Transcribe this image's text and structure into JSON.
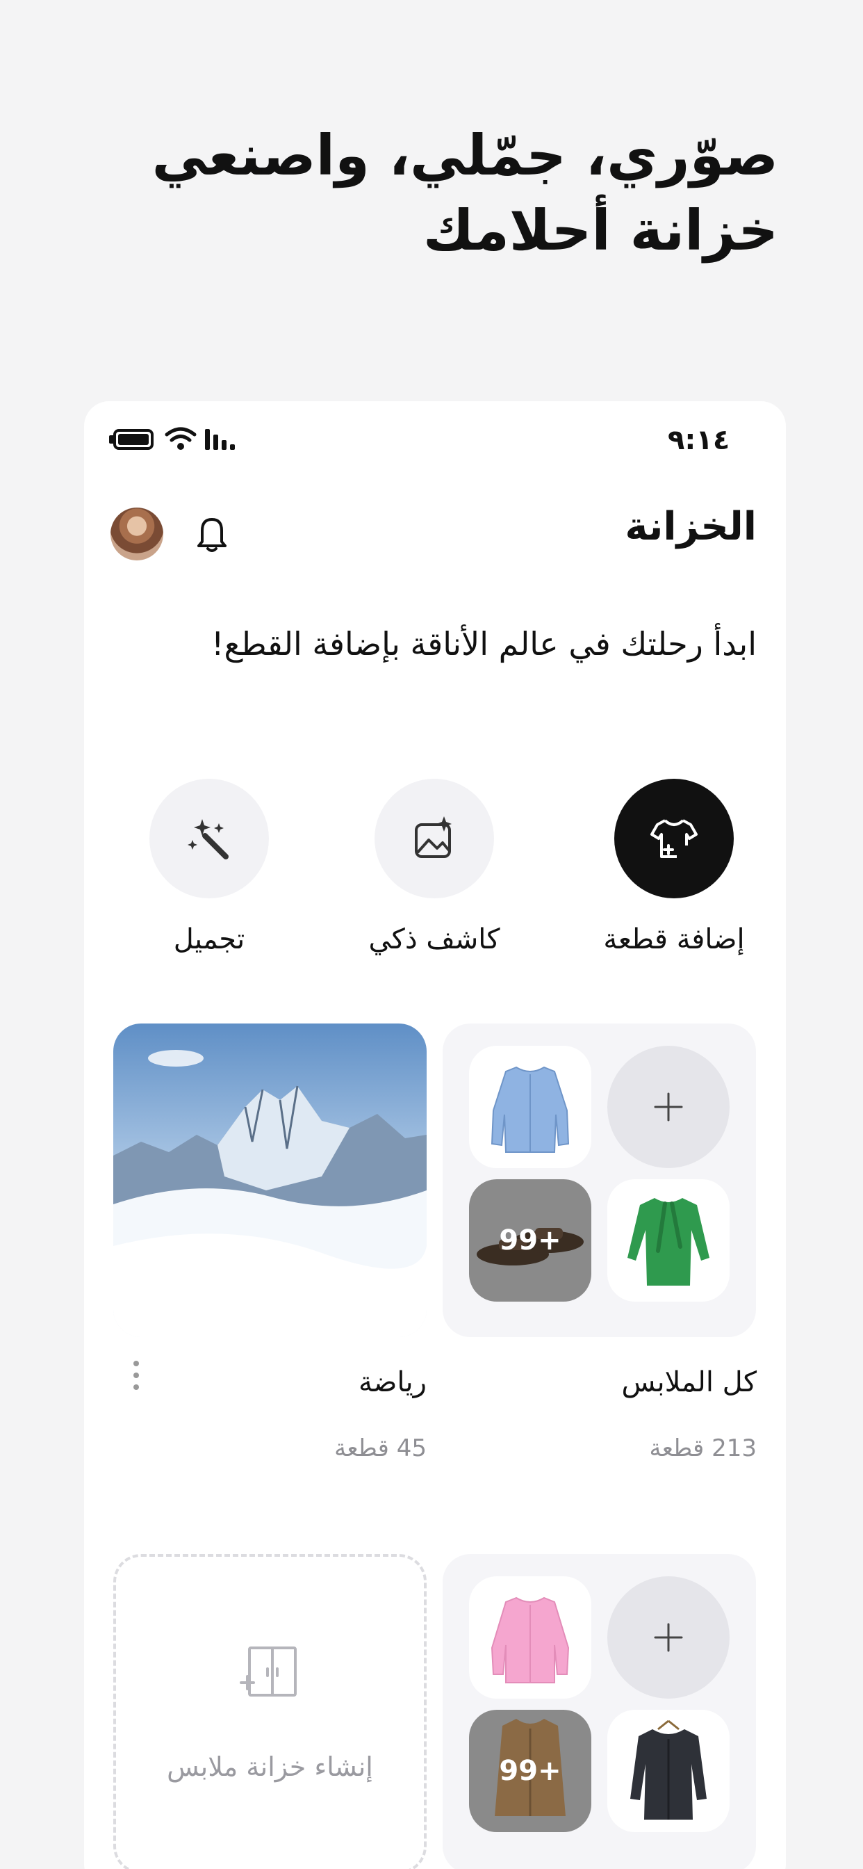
{
  "hero": {
    "line1": "صوّري، جمّلي، واصنعي",
    "line2": "خزانة أحلامك"
  },
  "status_bar": {
    "time": "٩:١٤"
  },
  "header": {
    "title": "الخزانة"
  },
  "subtitle": "ابدأ رحلتك في عالم الأناقة بإضافة القطع!",
  "actions": [
    {
      "label": "إضافة قطعة",
      "icon": "add-shirt-icon"
    },
    {
      "label": "كاشف ذكي",
      "icon": "image-sparkle-icon"
    },
    {
      "label": "تجميل",
      "icon": "magic-wand-icon"
    }
  ],
  "wardrobes": [
    {
      "name": "كل الملابس",
      "count": "213 قطعة",
      "more": "99+"
    },
    {
      "name": "رياضة",
      "count": "45 قطعة"
    },
    {
      "more": "99+"
    }
  ],
  "create": {
    "label": "إنشاء خزانة ملابس"
  },
  "colors": {
    "background": "#f4f4f5",
    "dark_button": "#111111",
    "muted_text": "#8e8e93"
  }
}
